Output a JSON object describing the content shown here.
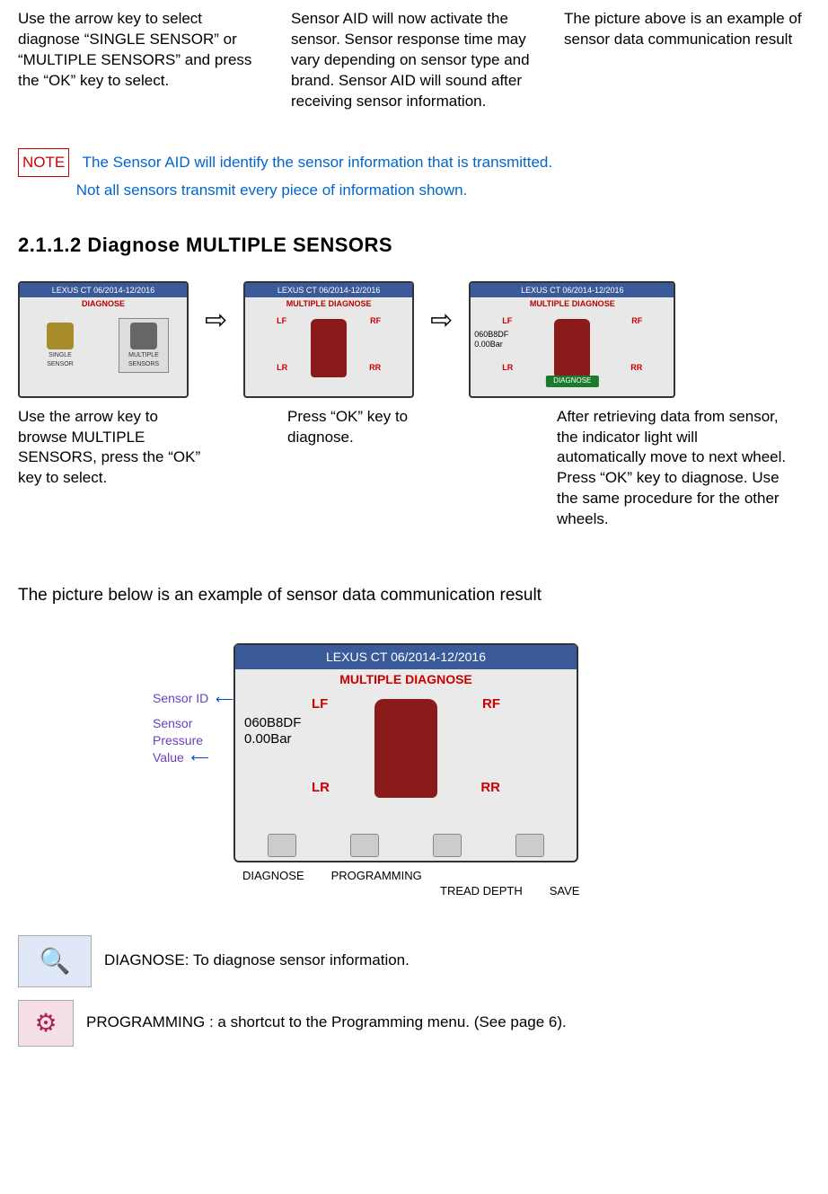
{
  "top_row": {
    "c1": "Use the arrow key to select diagnose “SINGLE SENSOR” or “MULTIPLE SENSORS” and press the “OK” key to select.",
    "c2": "Sensor AID will now activate the sensor. Sensor response time may vary depending on sensor type and brand. Sensor AID will sound after receiving sensor information.",
    "c3": "The picture above is an example of sensor data communication result"
  },
  "note": {
    "label": "NOTE",
    "line1": "The Sensor AID will identify the sensor information that is transmitted.",
    "line2": "Not all sensors transmit every piece of information shown."
  },
  "heading": "2.1.1.2 Diagnose MULTIPLE SENSORS",
  "screens": {
    "header": "LEXUS CT 06/2014-12/2016",
    "s1_sub": "DIAGNOSE",
    "s1_tile1": "SINGLE SENSOR",
    "s1_tile2": "MULTIPLE SENSORS",
    "s23_sub": "MULTIPLE DIAGNOSE",
    "lf": "LF",
    "rf": "RF",
    "lr": "LR",
    "rr": "RR",
    "readout_id": "060B8DF",
    "readout_val": "0.00Bar",
    "diag_btn": "DIAGNOSE"
  },
  "captions": {
    "c1": "Use the arrow key to browse MULTIPLE SENSORS, press the “OK” key to select.",
    "c2": "Press “OK” key to diagnose.",
    "c3": "After retrieving data from sensor, the indicator light will automatically move to next wheel. Press “OK” key to diagnose. Use the same procedure for the other wheels."
  },
  "below_text": "The picture below is an example of sensor data communication result",
  "annot": {
    "sensor_id": "Sensor ID",
    "sensor_pv": "Sensor Pressure Value"
  },
  "under_labels": {
    "l1": "DIAGNOSE",
    "l2": "PROGRAMMING",
    "l3": "TREAD DEPTH",
    "l4": "SAVE"
  },
  "legend": {
    "diag": "DIAGNOSE: To diagnose sensor information.",
    "prog": "PROGRAMMING : a shortcut to the Programming menu. (See page 6)."
  }
}
